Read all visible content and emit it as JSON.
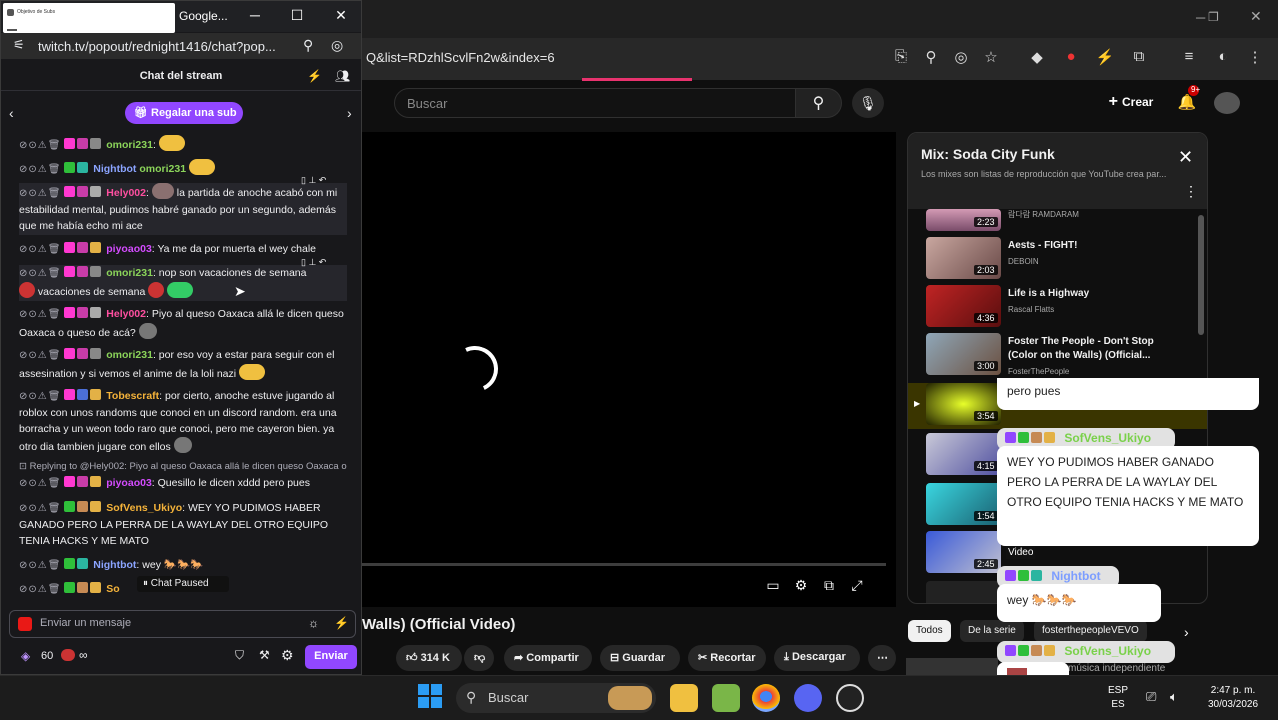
{
  "yt": {
    "url": "Q&list=RDzhlScvlFn2w&index=6",
    "search_placeholder": "Buscar",
    "create_label": "Crear",
    "notif_count": "9+",
    "video_title": "Walls) (Official Video)",
    "actions": {
      "likes": "314 K",
      "share": "Compartir",
      "save": "Guardar",
      "clip": "Recortar",
      "download": "Descargar"
    },
    "chips": [
      "Todos",
      "De la serie",
      "fosterthepeopleVEVO"
    ],
    "playlist": {
      "title": "Mix: Soda City Funk",
      "subtitle": "Los mixes son listas de reproducción que YouTube crea par...",
      "items": [
        {
          "duration": "2:23",
          "name": "",
          "channel": "람다람 RAMDARAM"
        },
        {
          "duration": "2:03",
          "name": "Aests - FIGHT!",
          "channel": "DEBOIN"
        },
        {
          "duration": "4:36",
          "name": "Life is a Highway",
          "channel": "Rascal Flatts"
        },
        {
          "duration": "3:00",
          "name": "Foster The People - Don't Stop (Color on the Walls) (Official...",
          "channel": "FosterThePeople"
        },
        {
          "duration": "3:54",
          "name": "",
          "channel": ""
        },
        {
          "duration": "4:15",
          "name": "",
          "channel": ""
        },
        {
          "duration": "1:54",
          "name": "",
          "channel": ""
        },
        {
          "duration": "2:45",
          "name": "",
          "channel": ""
        }
      ]
    },
    "side_label": "música independiente"
  },
  "overlay": {
    "msg1": "pero pues",
    "user2": "SofVens_Ukiyo",
    "msg2": "WEY YO PUDIMOS HABER GANADO PERO LA PERRA DE LA WAYLAY DEL OTRO EQUIPO TENIA HACKS Y ME MATO",
    "video_label": "Video",
    "user3": "Nightbot",
    "msg3": "wey",
    "user4": "SofVens_Ukiyo"
  },
  "chat_window": {
    "app_title": "Google...",
    "url": "twitch.tv/popout/rednight1416/chat?pop...",
    "thumb_title": "Objetivo de Subs",
    "header": "Chat del stream",
    "gift_label": "Regalar una sub",
    "messages": [
      {
        "user": "omori231",
        "text": ""
      },
      {
        "user": "Nightbot",
        "text": "omori231"
      },
      {
        "user": "Hely002",
        "text": "la partida de anoche acabó con mi estabilidad mental, pudimos habré ganado por un segundo, además que me había echo mi ace"
      },
      {
        "user": "piyoao03",
        "text": "Ya me da por muerta el wey chale"
      },
      {
        "user": "omori231",
        "text": "nop son vacaciones de semana",
        "text2": "vacaciones de semana"
      },
      {
        "user": "Hely002",
        "text": "Piyo al queso Oaxaca allá le dicen queso Oaxaca o queso de acá?"
      },
      {
        "user": "omori231",
        "text": "por eso voy a estar para seguir con el assesination y si vemos el anime de la loli nazi"
      },
      {
        "user": "Tobescraft",
        "text": "por cierto, anoche estuve jugando al roblox con unos randoms que conoci en un discord random. era una borracha y un weon todo raro que conoci, pero me cayeron bien. ya otro dia tambien jugare con ellos"
      },
      {
        "reply": "Replying to @Hely002: Piyo al queso Oaxaca allá le dicen queso Oaxaca o"
      },
      {
        "user": "piyoao03",
        "text": "Quesillo le dicen xddd pero pues"
      },
      {
        "user": "SofVens_Ukiyo",
        "text": "WEY YO PUDIMOS HABER GANADO PERO LA PERRA DE LA WAYLAY DEL OTRO EQUIPO TENIA HACKS Y ME MATO"
      },
      {
        "user": "Nightbot",
        "text": "wey"
      },
      {
        "user": "So",
        "text": ""
      }
    ],
    "paused_label": "Chat Paused",
    "input_placeholder": "Enviar un mensaje",
    "points": "60",
    "points_suffix": "∞",
    "send_label": "Enviar"
  },
  "taskbar": {
    "search_label": "Buscar",
    "lang_top": "ESP",
    "lang_bottom": "ES",
    "time": "2:47 p. m.",
    "date": "30/03/2026"
  },
  "colors": {
    "twitch_purple": "#9147ff",
    "yt_red": "#ff0033",
    "chat_bg": "#18181b"
  }
}
